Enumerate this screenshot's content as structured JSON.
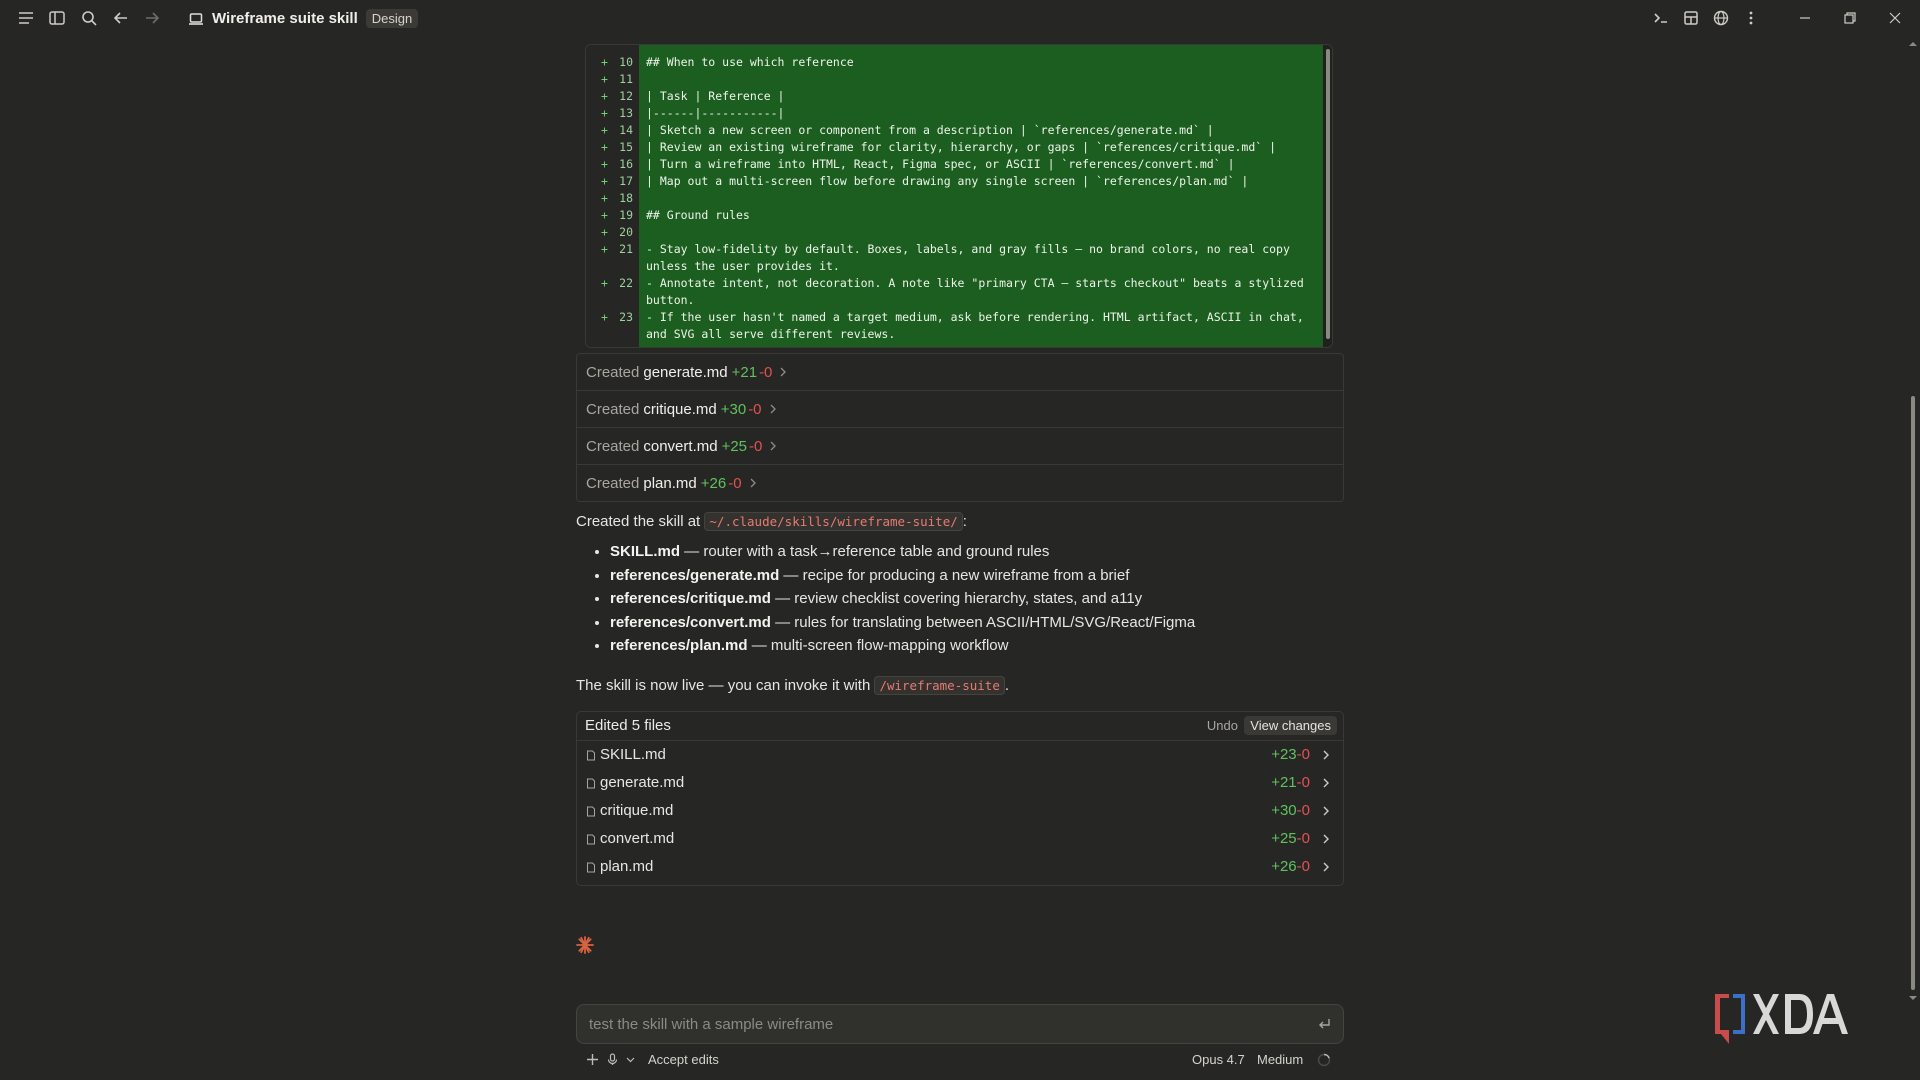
{
  "window": {
    "title": "Wireframe suite skill",
    "badge": "Design"
  },
  "diff": {
    "lines": [
      {
        "n": "10",
        "text": "## When to use which reference"
      },
      {
        "n": "11",
        "text": ""
      },
      {
        "n": "12",
        "text": "| Task | Reference |"
      },
      {
        "n": "13",
        "text": "|------|-----------|"
      },
      {
        "n": "14",
        "text": "| Sketch a new screen or component from a description | `references/generate.md` |"
      },
      {
        "n": "15",
        "text": "| Review an existing wireframe for clarity, hierarchy, or gaps | `references/critique.md` |"
      },
      {
        "n": "16",
        "text": "| Turn a wireframe into HTML, React, Figma spec, or ASCII | `references/convert.md` |"
      },
      {
        "n": "17",
        "text": "| Map out a multi-screen flow before drawing any single screen | `references/plan.md` |"
      },
      {
        "n": "18",
        "text": ""
      },
      {
        "n": "19",
        "text": "## Ground rules"
      },
      {
        "n": "20",
        "text": ""
      },
      {
        "n": "21",
        "text": "- Stay low-fidelity by default. Boxes, labels, and gray fills — no brand colors, no real copy unless the user provides it."
      },
      {
        "n": "22",
        "text": "- Annotate intent, not decoration. A note like \"primary CTA — starts checkout\" beats a stylized button."
      },
      {
        "n": "23",
        "text": "- If the user hasn't named a target medium, ask before rendering. HTML artifact, ASCII in chat, and SVG all serve different reviews."
      }
    ]
  },
  "created": [
    {
      "verb": "Created",
      "file": "generate.md",
      "add": "+21",
      "del": "-0"
    },
    {
      "verb": "Created",
      "file": "critique.md",
      "add": "+30",
      "del": "-0"
    },
    {
      "verb": "Created",
      "file": "convert.md",
      "add": "+25",
      "del": "-0"
    },
    {
      "verb": "Created",
      "file": "plan.md",
      "add": "+26",
      "del": "-0"
    }
  ],
  "summary": {
    "lead_prefix": "Created the skill at",
    "path": "~/.claude/skills/wireframe-suite/",
    "lead_suffix": ":",
    "bullets": [
      {
        "name": "SKILL.md",
        "desc": "— router with a task→reference table and ground rules"
      },
      {
        "name": "references/generate.md",
        "desc": "— recipe for producing a new wireframe from a brief"
      },
      {
        "name": "references/critique.md",
        "desc": "— review checklist covering hierarchy, states, and a11y"
      },
      {
        "name": "references/convert.md",
        "desc": "— rules for translating between ASCII/HTML/SVG/React/Figma"
      },
      {
        "name": "references/plan.md",
        "desc": "— multi-screen flow-mapping workflow"
      }
    ],
    "live_prefix": "The skill is now live — you can invoke it with",
    "command": "/wireframe-suite",
    "live_suffix": "."
  },
  "edited": {
    "title": "Edited 5 files",
    "undo": "Undo",
    "view_changes": "View changes",
    "files": [
      {
        "name": "SKILL.md",
        "add": "+23",
        "del": "-0"
      },
      {
        "name": "generate.md",
        "add": "+21",
        "del": "-0"
      },
      {
        "name": "critique.md",
        "add": "+30",
        "del": "-0"
      },
      {
        "name": "convert.md",
        "add": "+25",
        "del": "-0"
      },
      {
        "name": "plan.md",
        "add": "+26",
        "del": "-0"
      }
    ]
  },
  "prompt": {
    "placeholder": "test the skill with a sample wireframe"
  },
  "bottom": {
    "accept_edits": "Accept edits",
    "model": "Opus 4.7",
    "effort": "Medium"
  },
  "colors": {
    "background": "#262624",
    "diff_added_bg": "#1b5e20",
    "additions": "#5fc25f",
    "deletions": "#e05252",
    "spark": "#d9623f",
    "inline_code": "#e87a72"
  },
  "icons": {
    "menu": "menu-icon",
    "sidebar": "sidebar-toggle-icon",
    "search": "search-icon",
    "back": "arrow-left-icon",
    "forward": "arrow-right-icon",
    "laptop": "laptop-icon",
    "terminal": "terminal-icon",
    "layout": "layout-icon",
    "globe": "globe-icon",
    "more": "more-vertical-icon",
    "minimize": "minimize-icon",
    "maximize": "restore-icon",
    "close": "close-icon"
  }
}
